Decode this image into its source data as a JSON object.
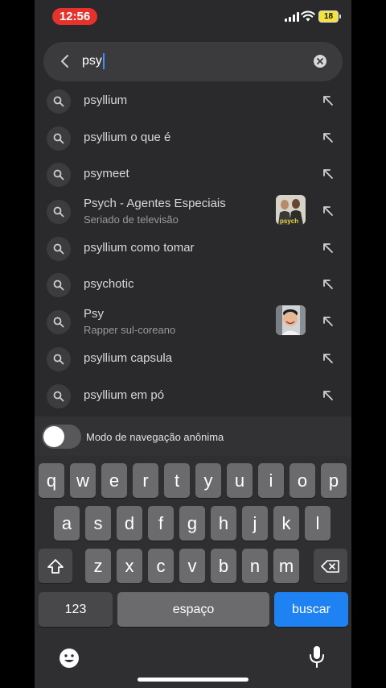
{
  "status": {
    "time": "12:56",
    "battery": "18"
  },
  "search": {
    "query": "psy"
  },
  "suggestions": [
    {
      "title": "psyllium",
      "subtitle": null
    },
    {
      "title": "psyllium o que é",
      "subtitle": null
    },
    {
      "title": "psymeet",
      "subtitle": null
    },
    {
      "title": "Psych - Agentes Especiais",
      "subtitle": "Seriado de televisão",
      "thumbnail_text": "psych"
    },
    {
      "title": "psyllium como tomar",
      "subtitle": null
    },
    {
      "title": "psychotic",
      "subtitle": null
    },
    {
      "title": "Psy",
      "subtitle": "Rapper sul-coreano"
    },
    {
      "title": "psyllium capsula",
      "subtitle": null
    },
    {
      "title": "psyllium em pó",
      "subtitle": null
    }
  ],
  "incognito": {
    "label": "Modo de navegação anônima",
    "enabled": false
  },
  "keyboard": {
    "row1": [
      "q",
      "w",
      "e",
      "r",
      "t",
      "y",
      "u",
      "i",
      "o",
      "p"
    ],
    "row2": [
      "a",
      "s",
      "d",
      "f",
      "g",
      "h",
      "j",
      "k",
      "l"
    ],
    "row3": [
      "z",
      "x",
      "c",
      "v",
      "b",
      "n",
      "m"
    ],
    "numbers_label": "123",
    "space_label": "espaço",
    "search_label": "buscar"
  },
  "colors": {
    "time_pill": "#e5322d",
    "battery": "#f4e23f",
    "caret": "#4a8cf7",
    "search_key": "#1f82f2"
  },
  "icons": {
    "back": "chevron-left-icon",
    "clear": "clear-icon",
    "suggestion": "search-icon",
    "fill": "arrow-up-left-icon",
    "shift": "shift-icon",
    "delete": "backspace-icon",
    "emoji": "emoji-icon",
    "mic": "microphone-icon"
  }
}
